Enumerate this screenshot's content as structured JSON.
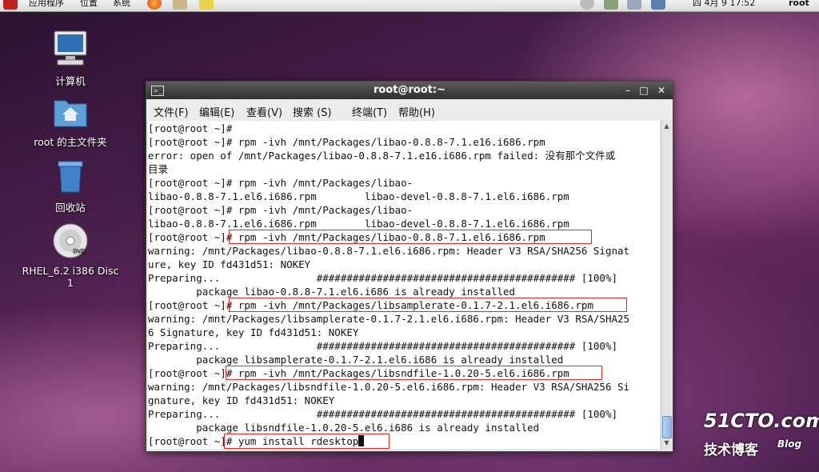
{
  "top_panel": {
    "menu_apps": "应用程序",
    "menu_places": "位置",
    "menu_system": "系统",
    "clock": "四  4月  9 17:52",
    "user": "root"
  },
  "desktop": {
    "icons": [
      {
        "label": "计算机"
      },
      {
        "label": "root 的主文件夹"
      },
      {
        "label": "回收站"
      },
      {
        "label": "RHEL_6.2 i386 Disc 1"
      }
    ],
    "dvd_text": "DVD"
  },
  "window": {
    "title": "root@root:~",
    "term_icon_glyph": ">_",
    "menu": [
      "文件(F)",
      "编辑(E)",
      "查看(V)",
      "搜索 (S)",
      "终端(T)",
      "帮助(H)"
    ]
  },
  "terminal": {
    "lines": [
      "[root@root ~]#",
      "[root@root ~]# rpm -ivh /mnt/Packages/libao-0.8.8-7.1.e16.i686.rpm",
      "error: open of /mnt/Packages/libao-0.8.8-7.1.e16.i686.rpm failed: 没有那个文件或",
      "目录",
      "[root@root ~]# rpm -ivh /mnt/Packages/libao-",
      "libao-0.8.8-7.1.el6.i686.rpm        libao-devel-0.8.8-7.1.el6.i686.rpm",
      "[root@root ~]# rpm -ivh /mnt/Packages/libao-",
      "libao-0.8.8-7.1.el6.i686.rpm        libao-devel-0.8.8-7.1.el6.i686.rpm",
      "[root@root ~]# rpm -ivh /mnt/Packages/libao-0.8.8-7.1.el6.i686.rpm",
      "warning: /mnt/Packages/libao-0.8.8-7.1.el6.i686.rpm: Header V3 RSA/SHA256 Signat",
      "ure, key ID fd431d51: NOKEY",
      "Preparing...                ########################################### [100%]",
      "        package libao-0.8.8-7.1.el6.i686 is already installed",
      "[root@root ~]# rpm -ivh /mnt/Packages/libsamplerate-0.1.7-2.1.el6.i686.rpm",
      "warning: /mnt/Packages/libsamplerate-0.1.7-2.1.el6.i686.rpm: Header V3 RSA/SHA25",
      "6 Signature, key ID fd431d51: NOKEY",
      "Preparing...                ########################################### [100%]",
      "        package libsamplerate-0.1.7-2.1.el6.i686 is already installed",
      "[root@root ~]# rpm -ivh /mnt/Packages/libsndfile-1.0.20-5.el6.i686.rpm",
      "warning: /mnt/Packages/libsndfile-1.0.20-5.el6.i686.rpm: Header V3 RSA/SHA256 Si",
      "gnature, key ID fd431d51: NOKEY",
      "Preparing...                ########################################### [100%]",
      "        package libsndfile-1.0.20-5.el6.i686 is already installed",
      "[root@root ~]# yum install rdesktop"
    ]
  },
  "watermark": {
    "brand": "51CTO.com",
    "sub": "技术博客",
    "blog": "Blog"
  },
  "colors": {
    "highlight_box": "#d63030",
    "titlebar": "#3a3a3a"
  }
}
